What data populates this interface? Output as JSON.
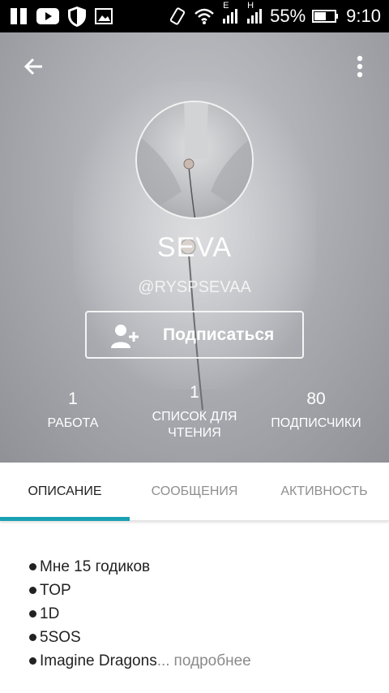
{
  "status_bar": {
    "network_1": "E",
    "network_2": "H",
    "battery": "55%",
    "time": "9:10"
  },
  "profile": {
    "name": "SEVA",
    "handle": "@RYSPSEVAA",
    "follow_label": "Подписаться",
    "stats": [
      {
        "value": "1",
        "label": "РАБОТА"
      },
      {
        "value": "1",
        "label_line1": "СПИСОК ДЛЯ",
        "label_line2": "ЧТЕНИЯ"
      },
      {
        "value": "80",
        "label": "ПОДПИСЧИКИ"
      }
    ]
  },
  "tabs": [
    {
      "label": "ОПИСАНИЕ",
      "active": true
    },
    {
      "label": "СООБЩЕНИЯ",
      "active": false
    },
    {
      "label": "АКТИВНОСТЬ",
      "active": false
    }
  ],
  "description": {
    "items": [
      "Мне 15 годиков",
      "TOP",
      "1D",
      "5SOS",
      "Imagine Dragons"
    ],
    "ellipsis": "...",
    "more": "подробнее"
  },
  "colors": {
    "accent": "#1aa0b3",
    "status_bar": "#000000"
  },
  "icons": {
    "back": "arrow-left-icon",
    "menu": "more-vert-icon",
    "follow": "person-add-icon"
  }
}
